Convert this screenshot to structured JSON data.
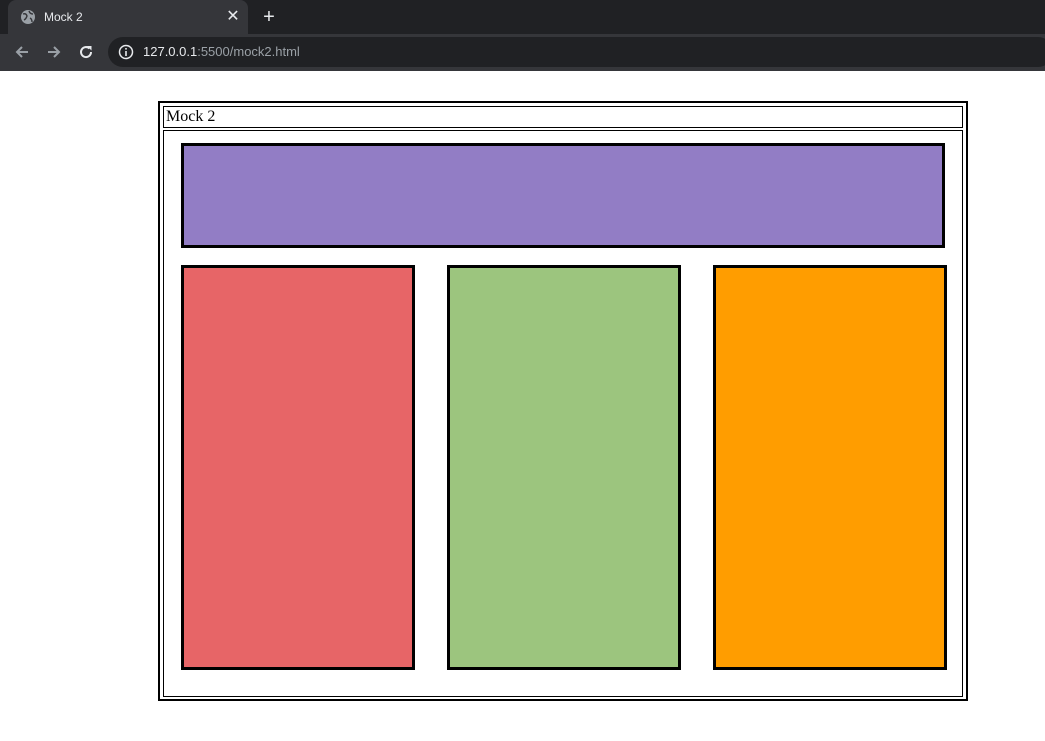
{
  "browser": {
    "tab": {
      "title": "Mock 2"
    },
    "new_tab_symbol": "+",
    "close_symbol": "✕",
    "address": {
      "host": "127.0.0.1",
      "rest": ":5500/mock2.html"
    }
  },
  "page": {
    "caption": "Mock 2",
    "blocks": {
      "header": {
        "color": "#927dc5"
      },
      "left": {
        "color": "#e76567"
      },
      "middle": {
        "color": "#9cc57e"
      },
      "right": {
        "color": "#ff9d00"
      }
    }
  }
}
